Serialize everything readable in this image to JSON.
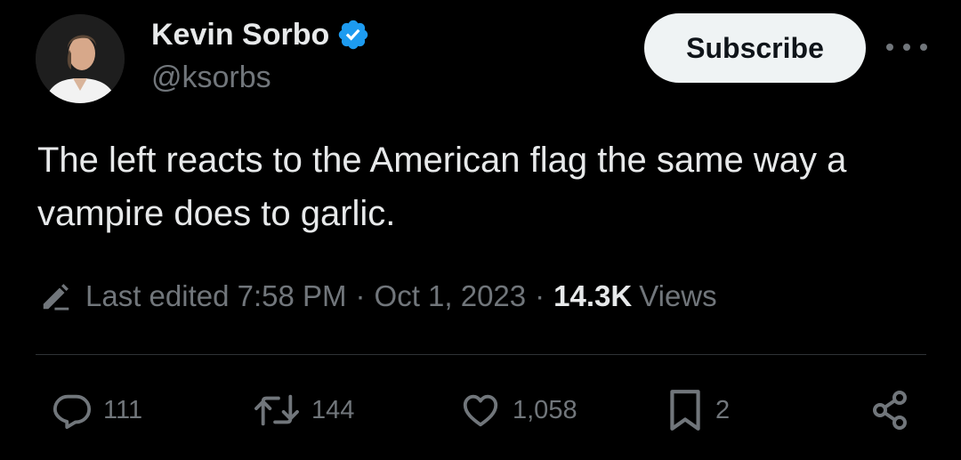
{
  "author": {
    "display_name": "Kevin Sorbo",
    "handle": "@ksorbs",
    "avatar_icon": "profile-photo",
    "verified_icon": "verified-badge-icon",
    "verified_color": "#1d9bf0"
  },
  "header": {
    "subscribe_label": "Subscribe",
    "more_icon": "more-options-icon"
  },
  "tweet": {
    "text": "The left reacts to the American flag the same way a vampire does to garlic."
  },
  "meta": {
    "edited_label": "Last edited 7:58 PM",
    "separator": "·",
    "date": "Oct 1, 2023",
    "views_count": "14.3K",
    "views_label": "Views"
  },
  "actions": {
    "replies": {
      "icon": "reply-icon",
      "count": "111"
    },
    "reposts": {
      "icon": "repost-icon",
      "count": "144"
    },
    "likes": {
      "icon": "heart-icon",
      "count": "1,058"
    },
    "bookmarks": {
      "icon": "bookmark-icon",
      "count": "2"
    },
    "share": {
      "icon": "share-icon"
    }
  },
  "colors": {
    "background": "#000000",
    "primary_text": "#e7e9ea",
    "secondary_text": "#71767b",
    "divider": "#2f3336",
    "button_bg": "#eff3f4"
  }
}
